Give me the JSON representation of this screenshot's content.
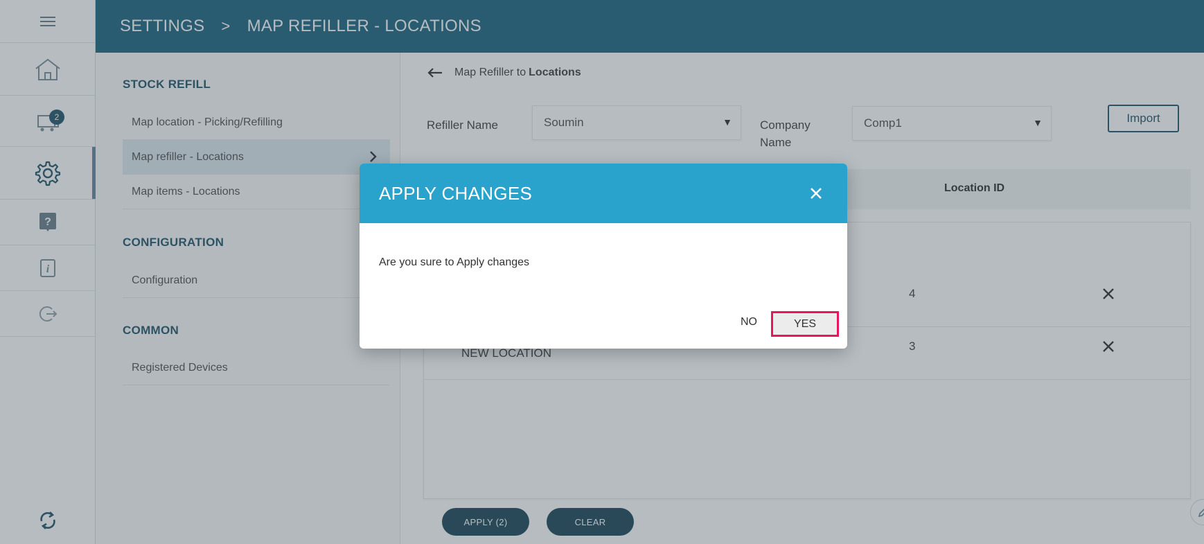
{
  "header": {
    "crumb_settings": "SETTINGS",
    "crumb_separator": ">",
    "crumb_page": "MAP REFILLER - LOCATIONS"
  },
  "rail": {
    "cart_badge": "2"
  },
  "settings_nav": {
    "sections": [
      {
        "title": "STOCK REFILL",
        "items": [
          "Map location - Picking/Refilling",
          "Map refiller - Locations",
          "Map items - Locations"
        ]
      },
      {
        "title": "CONFIGURATION",
        "items": [
          "Configuration"
        ]
      },
      {
        "title": "COMMON",
        "items": [
          "Registered Devices"
        ]
      }
    ],
    "active_item": "Map refiller - Locations"
  },
  "main": {
    "back_prefix": "Map Refiller to",
    "back_bold": "Locations",
    "refiller_label": "Refiller Name",
    "refiller_value": "Soumin",
    "company_label_1": "Company",
    "company_label_2": "Name",
    "company_value": "Comp1",
    "import_label": "Import",
    "table": {
      "col_location_id": "Location ID",
      "rows": [
        {
          "name": "",
          "id": "4"
        },
        {
          "name": "NEW LOCATION",
          "id": "3"
        }
      ]
    },
    "apply_label": "APPLY  (2)",
    "clear_label": "CLEAR"
  },
  "modal": {
    "title": "APPLY CHANGES",
    "message": "Are you sure to Apply changes",
    "no_label": "NO",
    "yes_label": "YES"
  },
  "colors": {
    "header_bg": "#0e5a78",
    "modal_header_bg": "#2aa3cc",
    "highlight_border": "#e8175d",
    "dark_button": "#0e3a4c"
  }
}
